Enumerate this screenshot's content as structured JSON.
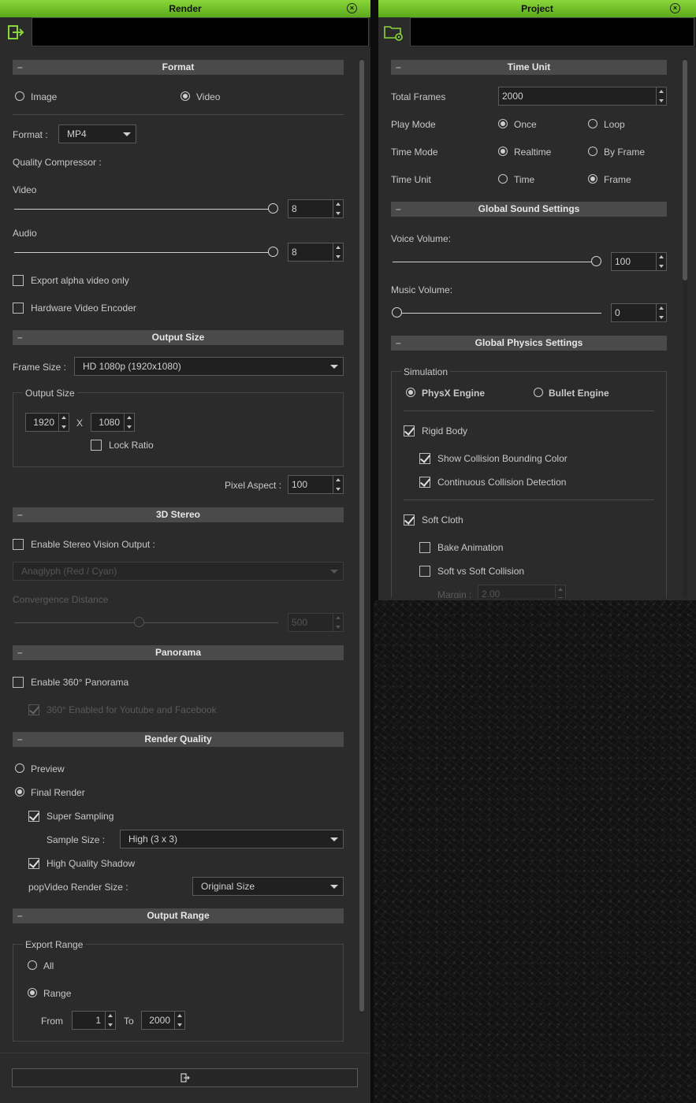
{
  "render": {
    "title": "Render",
    "close_icon": "close-icon",
    "tab_icon": "render-exit-icon",
    "format": {
      "header": "Format",
      "image_label": "Image",
      "video_label": "Video",
      "selected": "Video",
      "format_label": "Format :",
      "format_value": "MP4",
      "quality_label": "Quality Compressor :",
      "video_label2": "Video",
      "video_value": "8",
      "video_level": 1.0,
      "audio_label": "Audio",
      "audio_value": "8",
      "audio_level": 1.0,
      "export_alpha_label": "Export alpha video only",
      "export_alpha_checked": false,
      "hw_encoder_label": "Hardware Video Encoder",
      "hw_encoder_checked": false
    },
    "output_size": {
      "header": "Output Size",
      "frame_size_label": "Frame Size :",
      "frame_size_value": "HD 1080p (1920x1080)",
      "group_title": "Output Size",
      "width": "1920",
      "x_label": "X",
      "height": "1080",
      "lock_ratio_label": "Lock Ratio",
      "lock_ratio_checked": false,
      "pixel_aspect_label": "Pixel Aspect :",
      "pixel_aspect_value": "100"
    },
    "stereo": {
      "header": "3D Stereo",
      "enable_label": "Enable Stereo Vision Output :",
      "enable_checked": false,
      "mode_value": "Anaglyph (Red / Cyan)",
      "convergence_label": "Convergence Distance",
      "convergence_value": "500"
    },
    "panorama": {
      "header": "Panorama",
      "enable_label": "Enable 360° Panorama",
      "enable_checked": false,
      "youtube_label": "360° Enabled for Youtube and Facebook",
      "youtube_checked": true
    },
    "quality": {
      "header": "Render Quality",
      "preview_label": "Preview",
      "final_label": "Final Render",
      "selected": "Final Render",
      "super_sampling_label": "Super Sampling",
      "super_sampling_checked": true,
      "sample_size_label": "Sample Size :",
      "sample_size_value": "High (3 x 3)",
      "hq_shadow_label": "High Quality Shadow",
      "hq_shadow_checked": true,
      "popvideo_label": "popVideo Render Size :",
      "popvideo_value": "Original Size"
    },
    "range": {
      "header": "Output Range",
      "group_title": "Export Range",
      "all_label": "All",
      "range_label": "Range",
      "selected": "Range",
      "from_label": "From",
      "from_value": "1",
      "to_label": "To",
      "to_value": "2000"
    },
    "bottom_icon": "export-icon"
  },
  "project": {
    "title": "Project",
    "close_icon": "close-icon",
    "tab_icon": "project-settings-icon",
    "time_unit": {
      "header": "Time Unit",
      "total_frames_label": "Total Frames",
      "total_frames_value": "2000",
      "play_mode_label": "Play Mode",
      "once_label": "Once",
      "loop_label": "Loop",
      "play_mode_selected": "Once",
      "time_mode_label": "Time Mode",
      "realtime_label": "Realtime",
      "by_frame_label": "By Frame",
      "time_mode_selected": "Realtime",
      "time_unit_label": "Time Unit",
      "time_label": "Time",
      "frame_label": "Frame",
      "time_unit_selected": "Frame"
    },
    "sound": {
      "header": "Global Sound Settings",
      "voice_label": "Voice Volume:",
      "voice_value": "100",
      "voice_level": 1.0,
      "music_label": "Music Volume:",
      "music_value": "0",
      "music_level": 0.0
    },
    "physics": {
      "header": "Global Physics Settings",
      "simulation_title": "Simulation",
      "physx_label": "PhysX Engine",
      "bullet_label": "Bullet Engine",
      "engine_selected": "PhysX Engine",
      "rigid_body_label": "Rigid Body",
      "rigid_body_checked": true,
      "show_collision_label": "Show Collision Bounding Color",
      "show_collision_checked": true,
      "continuous_label": "Continuous Collision Detection",
      "continuous_checked": true,
      "soft_cloth_label": "Soft Cloth",
      "soft_cloth_checked": true,
      "bake_label": "Bake Animation",
      "bake_checked": false,
      "soft_vs_soft_label": "Soft vs Soft Collision",
      "soft_vs_soft_checked": false,
      "margin_label": "Margin :",
      "margin_value": "2.00"
    }
  },
  "colors": {
    "titlebar": "#6cc023",
    "panel_bg": "#2b2b2b",
    "section_header": "#4a4a4a"
  }
}
